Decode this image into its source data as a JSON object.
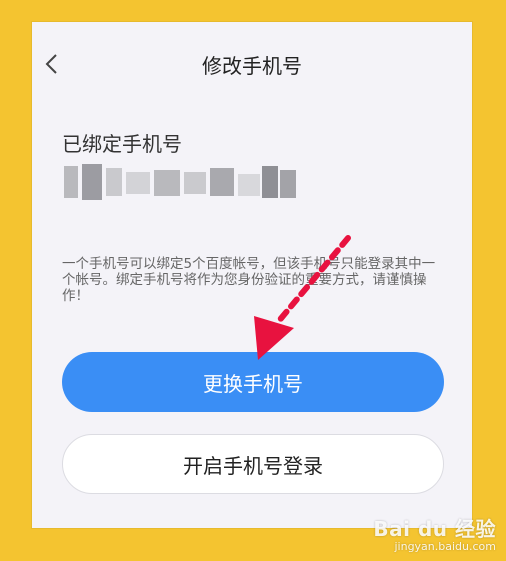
{
  "header": {
    "title": "修改手机号",
    "back_icon": "chevron-left-icon"
  },
  "bound_phone": {
    "label": "已绑定手机号",
    "masked_value": "137********3?"
  },
  "hint_text": "一个手机号可以绑定5个百度帐号，但该手机号只能登录其中一个帐号。绑定手机号将作为您身份验证的重要方式，请谨慎操作！",
  "buttons": {
    "change_phone": "更换手机号",
    "enable_phone_login": "开启手机号登录"
  },
  "annotation": {
    "arrow_color": "#e8123f",
    "points_to": "change_phone"
  },
  "colors": {
    "primary": "#3a8ef5",
    "background": "#f4c430",
    "screen": "#f4f3f8"
  },
  "watermark": {
    "brand": "Bai du 经验",
    "url": "jingyan.baidu.com"
  }
}
